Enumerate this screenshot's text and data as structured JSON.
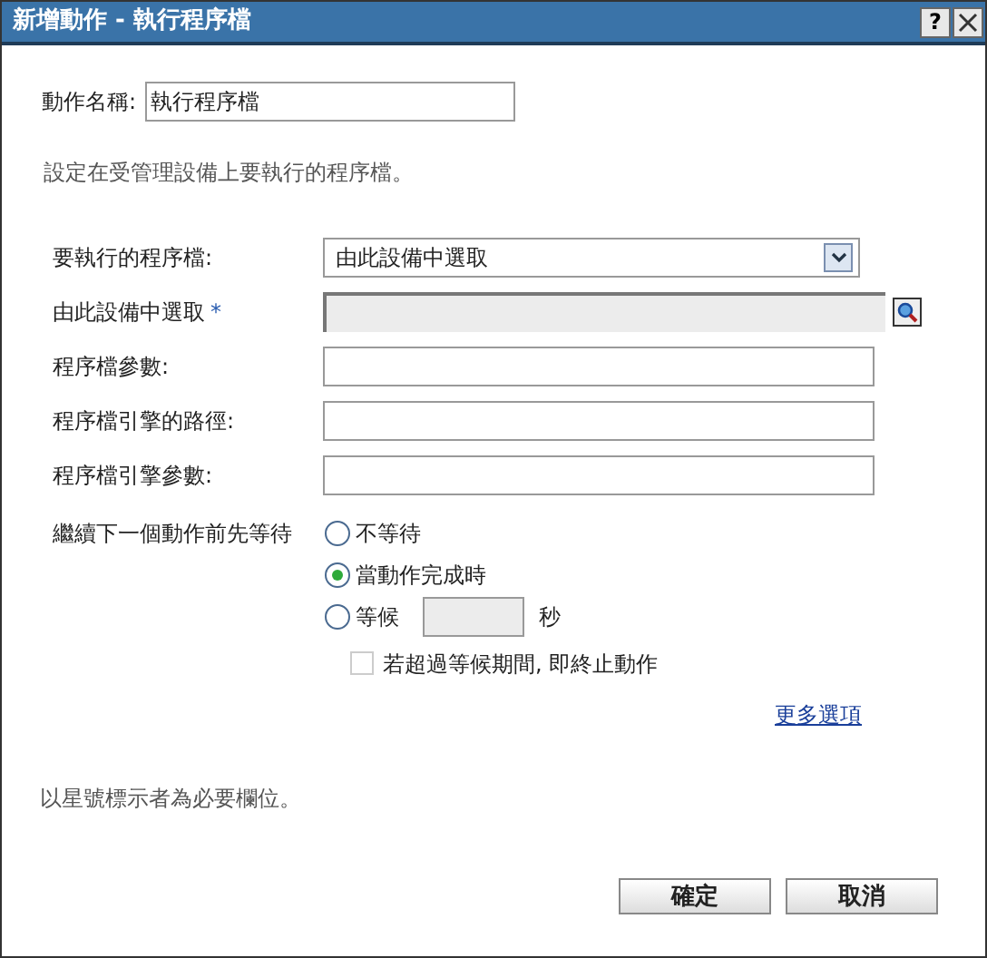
{
  "window": {
    "title": "新增動作 - 執行程序檔",
    "help": "?"
  },
  "action_name": {
    "label": "動作名稱:",
    "value": "執行程序檔"
  },
  "description": "設定在受管理設備上要執行的程序檔。",
  "rows": [
    {
      "kind": "select",
      "label": "要執行的程序檔:",
      "value": "由此設備中選取",
      "disabled": false
    },
    {
      "kind": "browse",
      "label": "由此設備中選取",
      "required_mark": "*",
      "disabled": true
    },
    {
      "kind": "text",
      "label": "程序檔參數:",
      "disabled": false
    },
    {
      "kind": "text",
      "label": "程序檔引擎的路徑:",
      "disabled": false
    },
    {
      "kind": "text",
      "label": "程序檔引擎參數:",
      "disabled": false
    }
  ],
  "wait": {
    "label": "繼續下一個動作前先等待",
    "options": [
      {
        "label": "不等待",
        "selected": false
      },
      {
        "label": "當動作完成時",
        "selected": true
      },
      {
        "label": "等候",
        "selected": false,
        "unit": "秒",
        "field_disabled": true
      }
    ],
    "terminate": {
      "label": "若超過等候期間, 即終止動作",
      "checked": false,
      "disabled": true
    }
  },
  "more_link": "更多選項",
  "note": "以星號標示者為必要欄位。",
  "buttons": [
    "確定",
    "取消"
  ]
}
